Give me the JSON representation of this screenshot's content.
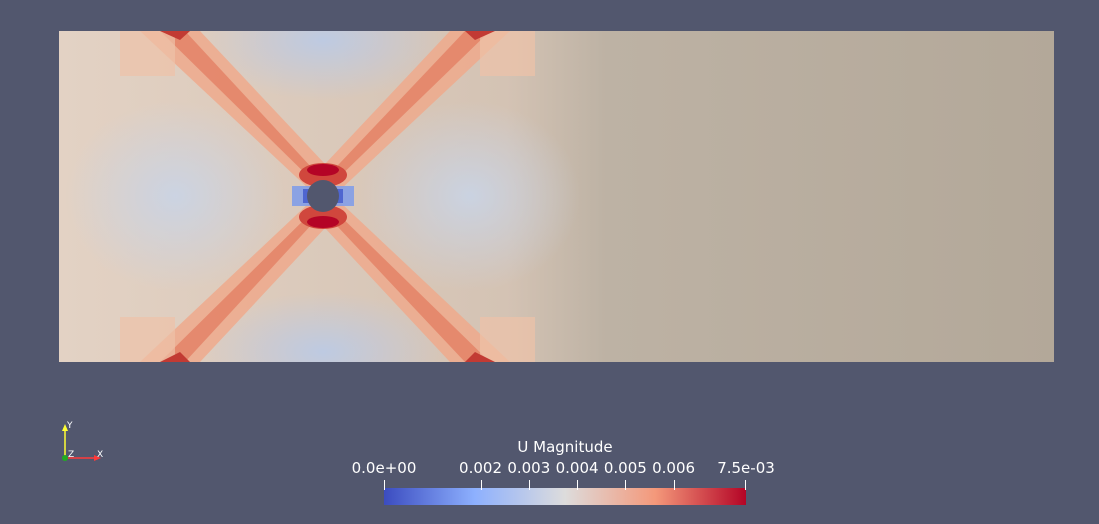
{
  "legend": {
    "title": "U Magnitude",
    "ticks": [
      {
        "label": "0.0e+00",
        "value": 0.0
      },
      {
        "label": "0.002",
        "value": 0.002
      },
      {
        "label": "0.003",
        "value": 0.003
      },
      {
        "label": "0.004",
        "value": 0.004
      },
      {
        "label": "0.005",
        "value": 0.005
      },
      {
        "label": "0.006",
        "value": 0.006
      },
      {
        "label": "7.5e-03",
        "value": 0.0075
      }
    ],
    "range": [
      0.0,
      0.0075
    ],
    "colormap": [
      "#3b4cc0",
      "#8db0fe",
      "#dddcdc",
      "#f4987a",
      "#b40426"
    ]
  },
  "axes": {
    "x_label": "X",
    "y_label": "Y",
    "z_label": "Z",
    "x_color": "#ff3a3a",
    "y_color": "#ffff33",
    "z_color": "#22aa22"
  },
  "colors": {
    "background": "#52576e",
    "domain_base": "#b3a899",
    "low": "#3b4cc0",
    "high": "#b40426"
  }
}
